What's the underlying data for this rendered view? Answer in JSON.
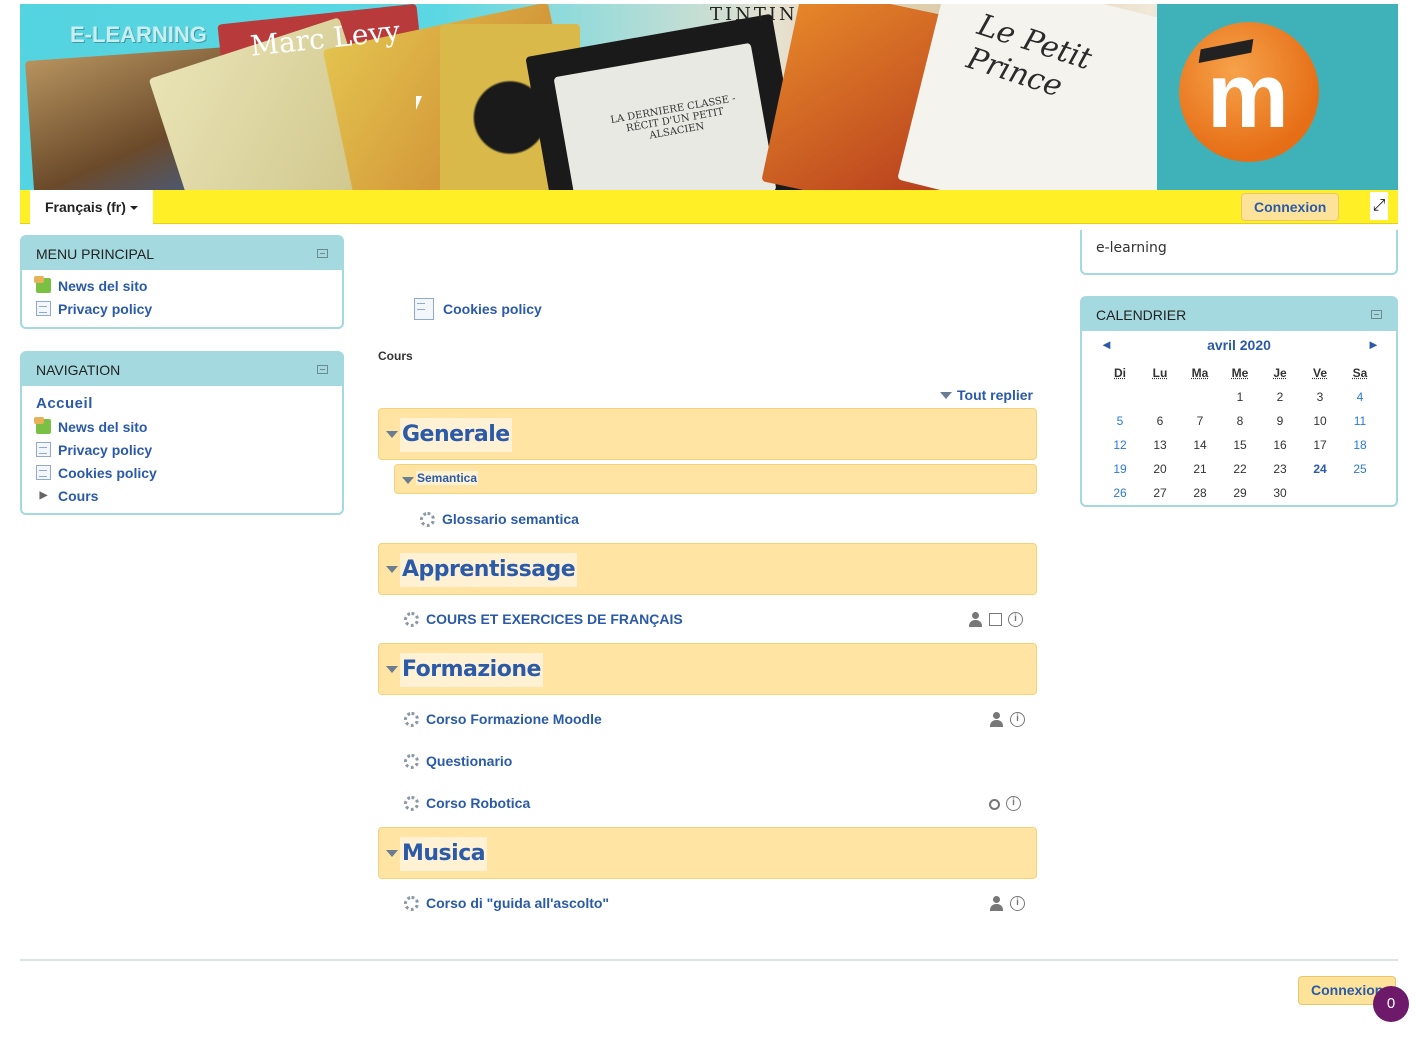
{
  "header": {
    "site_title": "E-LEARNING",
    "banner_texts": {
      "book1": "Marc Levy",
      "book2": "TINTIN",
      "book3": "Le Petit Prince",
      "ebook": "LA DERNIERE CLASSE - RÉCIT D'UN PETIT ALSACIEN"
    },
    "logo_letter": "m",
    "language": "Français (fr)",
    "login": "Connexion",
    "expand_icon": "expand-icon"
  },
  "menu_principal": {
    "title": "MENU PRINCIPAL",
    "items": [
      {
        "label": "News del sito",
        "icon": "news-icon"
      },
      {
        "label": "Privacy policy",
        "icon": "page-icon"
      }
    ]
  },
  "navigation": {
    "title": "NAVIGATION",
    "home": "Accueil",
    "items": [
      {
        "label": "News del sito",
        "icon": "news-icon"
      },
      {
        "label": "Privacy policy",
        "icon": "page-icon"
      },
      {
        "label": "Cookies policy",
        "icon": "page-icon"
      },
      {
        "label": "Cours",
        "icon": "chevron-right-icon"
      }
    ]
  },
  "right_top_block": {
    "text": "e-learning"
  },
  "calendar": {
    "title": "CALENDRIER",
    "month": "avril 2020",
    "prev": "◄",
    "next": "►",
    "weekdays": [
      "Di",
      "Lu",
      "Ma",
      "Me",
      "Je",
      "Ve",
      "Sa"
    ],
    "weeks": [
      [
        "",
        "",
        "",
        "1",
        "2",
        "3",
        "4"
      ],
      [
        "5",
        "6",
        "7",
        "8",
        "9",
        "10",
        "11"
      ],
      [
        "12",
        "13",
        "14",
        "15",
        "16",
        "17",
        "18"
      ],
      [
        "19",
        "20",
        "21",
        "22",
        "23",
        "24",
        "25"
      ],
      [
        "26",
        "27",
        "28",
        "29",
        "30",
        "",
        ""
      ]
    ],
    "today": "24"
  },
  "main": {
    "cookies_link": "Cookies policy",
    "cours_label": "Cours",
    "collapse_all": "Tout replier",
    "categories": [
      {
        "name": "Generale"
      },
      {
        "name": "Apprentissage"
      },
      {
        "name": "Formazione"
      },
      {
        "name": "Musica"
      }
    ],
    "subcategory": "Semantica",
    "courses": {
      "glossario": "Glossario semantica",
      "cours_fr": "COURS ET EXERCICES DE FRANÇAIS",
      "moodle": "Corso Formazione Moodle",
      "questionario": "Questionario",
      "robotica": "Corso Robotica",
      "ascolto": "Corso di \"guida all'ascolto\""
    },
    "info_glyph": "i"
  },
  "footer": {
    "login": "Connexion",
    "badge_count": "0"
  }
}
